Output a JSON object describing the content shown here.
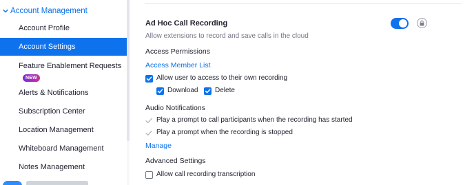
{
  "sidebar": {
    "section": "Account Management",
    "items": [
      {
        "label": "Account Profile",
        "active": false
      },
      {
        "label": "Account Settings",
        "active": true
      },
      {
        "label": "Feature Enablement Requests",
        "active": false,
        "badge": "NEW"
      },
      {
        "label": "Alerts & Notifications",
        "active": false
      },
      {
        "label": "Subscription Center",
        "active": false
      },
      {
        "label": "Location Management",
        "active": false
      },
      {
        "label": "Whiteboard Management",
        "active": false
      },
      {
        "label": "Notes Management",
        "active": false
      }
    ]
  },
  "setting": {
    "title": "Ad Hoc Call Recording",
    "description": "Allow extensions to record and save calls in the cloud",
    "enabled": true,
    "access_permissions_heading": "Access Permissions",
    "access_member_list_link": "Access Member List",
    "allow_own_recording": {
      "label": "Allow user to access to their own recording",
      "checked": true
    },
    "download": {
      "label": "Download",
      "checked": true
    },
    "delete": {
      "label": "Delete",
      "checked": true
    },
    "audio_notifications_heading": "Audio Notifications",
    "prompt_start": "Play a prompt to call participants when the recording has started",
    "prompt_stop": "Play a prompt when the recording is stopped",
    "manage_link": "Manage",
    "advanced_heading": "Advanced Settings",
    "transcription": {
      "label": "Allow call recording transcription",
      "checked": false
    }
  },
  "colors": {
    "accent": "#0e72ed",
    "badge": "#9b2fc9",
    "muted": "#747487"
  },
  "icons": [
    "chevron-down-icon",
    "lock-icon",
    "checkbox-icon",
    "checkmark-icon"
  ]
}
